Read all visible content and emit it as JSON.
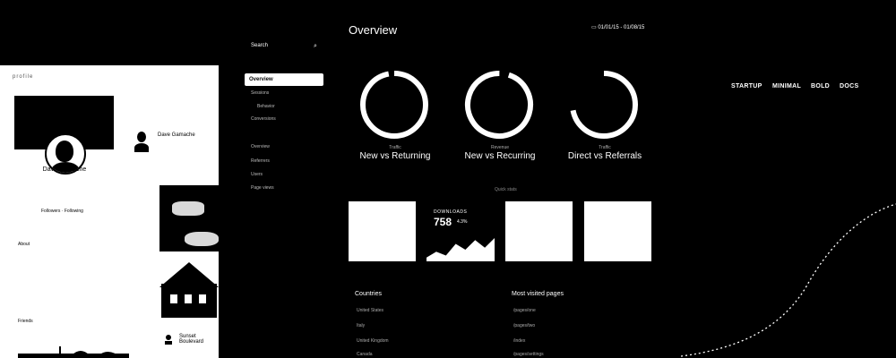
{
  "profile": {
    "name": "Dave Gamache",
    "brand_text": "profile",
    "about_label": "About",
    "friends_label": "Friends",
    "followers_label": "Followers",
    "second_name": "Dave Gamache",
    "photo_caption": "Sunset Boulevard",
    "meta_text": "Followers · Following"
  },
  "sidebar": {
    "search_placeholder": "Search",
    "active_item": "Overview",
    "items": [
      "Sessions",
      "Behavior",
      "Conversions",
      "Overview",
      "Referrers",
      "Users",
      "Page views"
    ]
  },
  "header": {
    "title": "Overview",
    "date_range": "01/01/15 - 01/08/15"
  },
  "nav": {
    "items": [
      "STARTUP",
      "MINIMAL",
      "BOLD",
      "DOCS"
    ]
  },
  "donuts": [
    {
      "caption": "Traffic",
      "label": "New vs Returning",
      "fraction": 0.97,
      "start": 0.0
    },
    {
      "caption": "Revenue",
      "label": "New vs Recurring",
      "fraction": 0.95,
      "start": 0.05
    },
    {
      "caption": "Traffic",
      "label": "Direct vs Referrals",
      "fraction": 0.72,
      "start": 0.0
    }
  ],
  "section_caption": "Quick stats",
  "downloads": {
    "label": "DOWNLOADS",
    "value": "758",
    "change": "4.3%",
    "sparkline": [
      2,
      5,
      3,
      9,
      6,
      11,
      7,
      12
    ]
  },
  "countries": {
    "title": "Countries",
    "items": [
      "United States",
      "Italy",
      "United Kingdom",
      "Canada"
    ]
  },
  "pages": {
    "title": "Most visited pages",
    "items": [
      "/pages/one",
      "/pages/two",
      "/index",
      "/pages/settings"
    ]
  },
  "colors": {
    "background": "#000000",
    "foreground": "#ffffff"
  }
}
